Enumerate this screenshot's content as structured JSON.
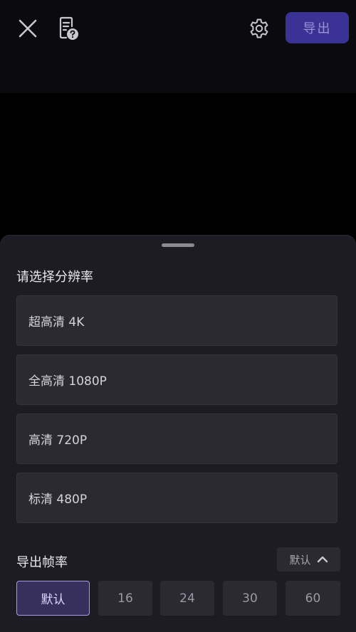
{
  "topbar": {
    "icons": {
      "close": "close-icon",
      "help": "document-question-icon",
      "settings": "gear-icon"
    },
    "export_label": "导出"
  },
  "resolution": {
    "title": "请选择分辨率",
    "options": [
      {
        "label": "超高清 4K"
      },
      {
        "label": "全高清 1080P"
      },
      {
        "label": "高清 720P"
      },
      {
        "label": "标清 480P"
      }
    ]
  },
  "frame_rate": {
    "title": "导出帧率",
    "toggle_label": "默认",
    "options": [
      {
        "label": "默认",
        "selected": true
      },
      {
        "label": "16"
      },
      {
        "label": "24"
      },
      {
        "label": "30"
      },
      {
        "label": "60"
      }
    ]
  },
  "colors": {
    "accent": "#3a3294",
    "selected_border": "#a99be6",
    "sheet_bg": "#1d1c24",
    "option_bg": "#2b2a33"
  }
}
